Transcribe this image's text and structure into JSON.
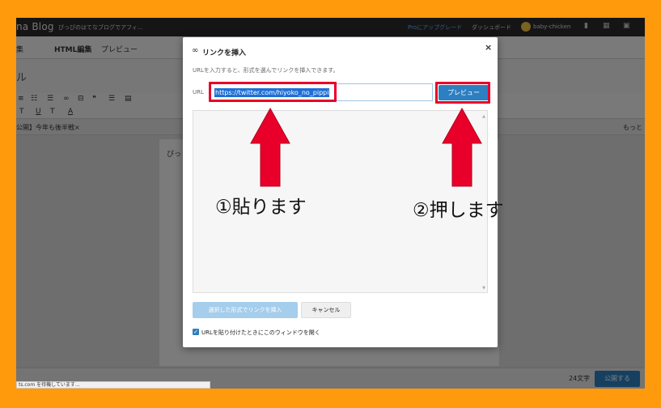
{
  "topbar": {
    "brand": "na Blog",
    "blog_name": "ぴっぴのはてなブログでアフィ...",
    "upgrade_link": "Proにアップグレード",
    "dashboard_link": "ダッシュボード",
    "username": "baby-chicken"
  },
  "editor_tabs": {
    "tab_edit": "集",
    "tab_html": "HTML編集",
    "tab_preview": "プレビュー"
  },
  "title_area": {
    "title_text": "ル"
  },
  "toolbar": {
    "row1": [
      "≡",
      "☷",
      "☰",
      "∞",
      "⊟",
      "❝",
      "☰",
      "▤"
    ],
    "row2": {
      "strike": "T",
      "underline": "U",
      "small_t": "T",
      "color_a": "A"
    }
  },
  "category_row": {
    "tag_text": "公開】今年も後半戦×",
    "more_text": "もっと"
  },
  "content": {
    "text": "ぴっ"
  },
  "bottom_bar": {
    "char_count": "24文字",
    "publish_label": "公開する"
  },
  "status_tip": "ts.com を待機しています...",
  "modal": {
    "title": "リンクを挿入",
    "close_label": "×",
    "description": "URLを入力すると、形式を選んでリンクを挿入できます。",
    "url_label": "URL",
    "url_value": "https://twitter.com/hiyoko_no_pippi",
    "preview_button": "プレビュー",
    "insert_button": "選択した形式でリンクを挿入",
    "cancel_button": "キャンセル",
    "checkbox_label": "URLを貼り付けたときにこのウィンドウを開く"
  },
  "annotations": {
    "paste": "①貼ります",
    "press": "②押します"
  },
  "colors": {
    "accent": "#2c7fc1",
    "highlight": "#e8002a",
    "frame_bg": "#ff9a0d"
  }
}
